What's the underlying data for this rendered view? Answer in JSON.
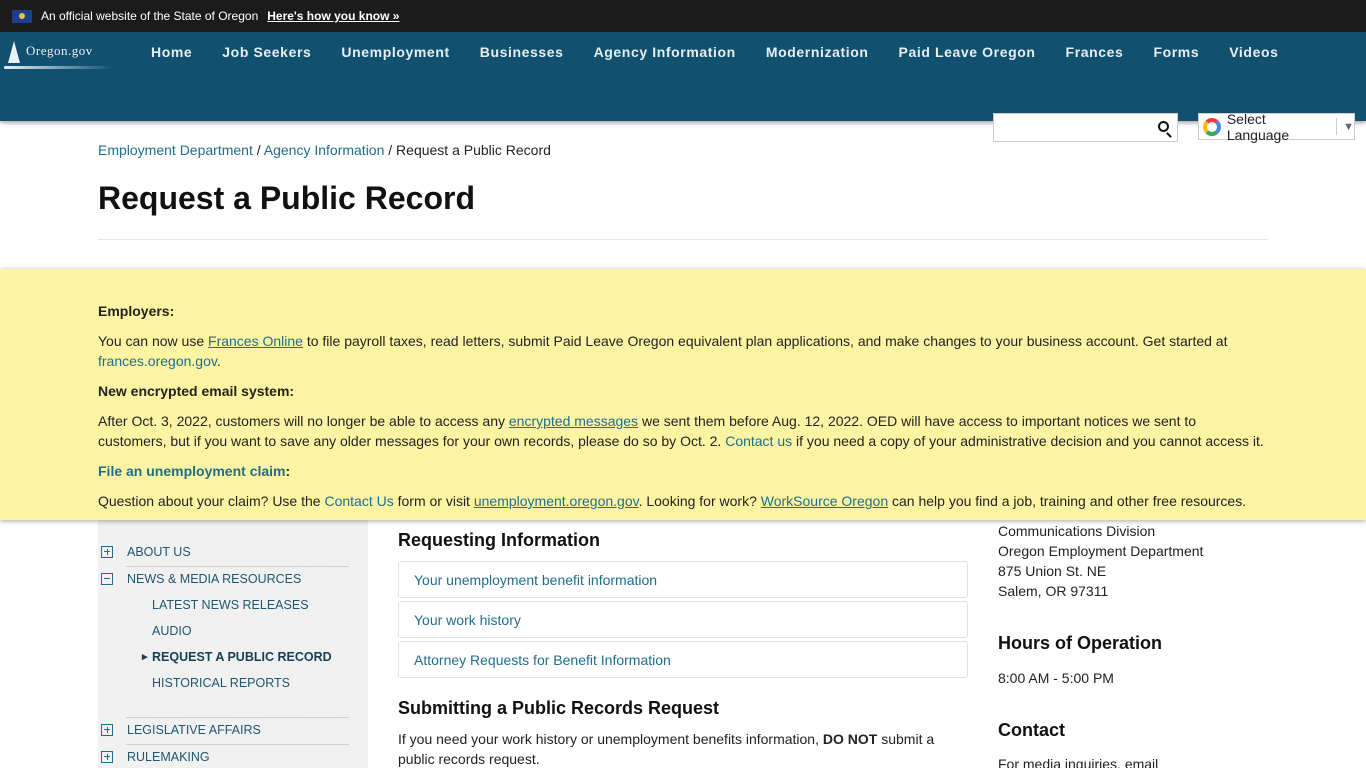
{
  "official_banner": {
    "text": "An official website of the State of Oregon",
    "link": "Here's how you know »"
  },
  "header": {
    "logo_text": "Oregon.gov",
    "nav": [
      "Home",
      "Job Seekers",
      "Unemployment",
      "Businesses",
      "Agency Information",
      "Modernization",
      "Paid Leave Oregon",
      "Frances",
      "Forms",
      "Videos"
    ],
    "search": {
      "value": "",
      "placeholder": ""
    },
    "language": {
      "label": "Select Language",
      "arrow": "▼"
    }
  },
  "breadcrumb": {
    "items": [
      "Employment Department",
      "Agency Information"
    ],
    "separator": "/",
    "current": "Request a Public Record"
  },
  "page_title": "Request a Public Record",
  "alert": {
    "employers_heading": "Employers:",
    "employers_p1": "You can now use ",
    "employers_link": "Frances Online",
    "employers_p2": " to file payroll taxes, read letters, submit Paid Leave Oregon equivalent plan applications, and make changes to your business account. Get started at ",
    "employers_link2": "frances.oregon.gov",
    "employers_p3": ".",
    "email_heading": "New encrypted email system:",
    "email_p1": "After Oct. 3, 2022, customers will no longer be able to access any ",
    "email_link": "encrypted messages",
    "email_p2": " we sent them before Aug. 12, 2022. OED will have access to important notices we sent to customers, but if you want to save any older messages for your own records, please do so by Oct. 2. ",
    "email_link2": "Contact us",
    "email_p3": " if you need a copy of your administrative decision and you cannot access it.",
    "claim_heading_link": "File an unemployment claim",
    "claim_heading_suffix": ":",
    "claim_p1": "Question about your claim? Use the ",
    "claim_link1": "Contact Us",
    "claim_p2": " form or visit ",
    "claim_link2": "unemployment.oregon.gov",
    "claim_p3": ". Looking for work? ",
    "claim_link3": "WorkSource Oregon",
    "claim_p4": " can help you find a job, training and other free resources."
  },
  "sidebar": {
    "sections": [
      {
        "label": "ABOUT US",
        "expanded": false
      },
      {
        "label": "NEWS & MEDIA RESOURCES",
        "expanded": true,
        "children": [
          "LATEST NEWS RELEASES",
          "AUDIO",
          "REQUEST A PUBLIC RECORD",
          "HISTORICAL REPORTS"
        ],
        "active_child": "REQUEST A PUBLIC RECORD"
      },
      {
        "label": "LEGISLATIVE AFFAIRS",
        "expanded": false
      },
      {
        "label": "RULEMAKING",
        "expanded": false
      }
    ]
  },
  "main": {
    "requesting_heading": "Requesting Information",
    "cards": [
      "Your unemployment benefit information",
      "Your work history",
      "Attorney Requests for Benefit Information"
    ],
    "submitting_heading": "Submitting a Public Records Request",
    "submitting_p1": "If you need your work history or unemployment benefits information, ",
    "submitting_bold": "DO NOT",
    "submitting_p2": " submit a public records request."
  },
  "right": {
    "address": [
      "Communications Division",
      "Oregon Employment Department",
      "875 Union St. NE",
      "Salem, OR 97311"
    ],
    "hours_heading": "Hours of Operation",
    "hours": "8:00 AM  - 5:00 PM",
    "contact_heading": "Contact",
    "contact_text": "For media inquiries, email"
  },
  "colors": {
    "nav_bg": "#11506f",
    "banner_bg": "#1b1b1b",
    "alert_bg": "#fdf4a3",
    "link": "#1f6e8c"
  }
}
